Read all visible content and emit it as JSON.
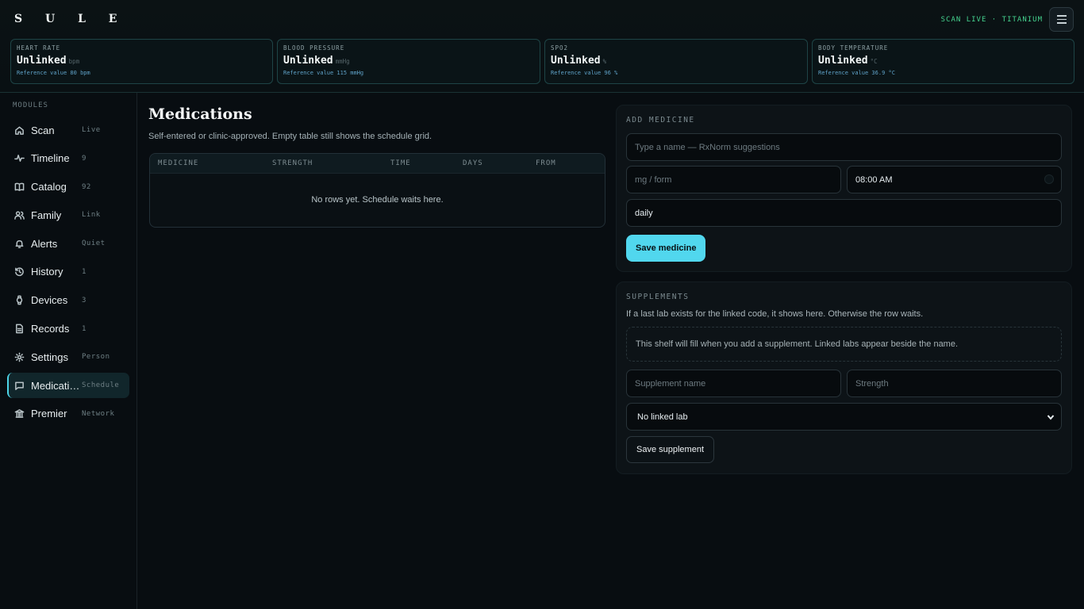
{
  "app": {
    "logo": "S U L E",
    "scan_status": "SCAN LIVE · TITANIUM"
  },
  "vitals": [
    {
      "label": "HEART RATE",
      "value": "Unlinked",
      "unit": "bpm",
      "reference": "Reference value 80 bpm"
    },
    {
      "label": "BLOOD PRESSURE",
      "value": "Unlinked",
      "unit": "mmHg",
      "reference": "Reference value 115 mmHg"
    },
    {
      "label": "SPO2",
      "value": "Unlinked",
      "unit": "%",
      "reference": "Reference value 96 %"
    },
    {
      "label": "BODY TEMPERATURE",
      "value": "Unlinked",
      "unit": "°C",
      "reference": "Reference value 36.9 °C"
    }
  ],
  "sidebar": {
    "section_label": "MODULES",
    "items": [
      {
        "label": "Scan",
        "badge": "Live",
        "icon": "home-icon"
      },
      {
        "label": "Timeline",
        "badge": "9",
        "icon": "pulse-icon"
      },
      {
        "label": "Catalog",
        "badge": "92",
        "icon": "book-icon"
      },
      {
        "label": "Family",
        "badge": "Link",
        "icon": "users-icon"
      },
      {
        "label": "Alerts",
        "badge": "Quiet",
        "icon": "bell-icon"
      },
      {
        "label": "History",
        "badge": "1",
        "icon": "history-icon"
      },
      {
        "label": "Devices",
        "badge": "3",
        "icon": "watch-icon"
      },
      {
        "label": "Records",
        "badge": "1",
        "icon": "file-icon"
      },
      {
        "label": "Settings",
        "badge": "Person",
        "icon": "gear-icon"
      },
      {
        "label": "Medications",
        "badge": "Schedule",
        "icon": "message-icon"
      },
      {
        "label": "Premier",
        "badge": "Network",
        "icon": "bank-icon"
      }
    ]
  },
  "main": {
    "title": "Medications",
    "subtitle": "Self-entered or clinic-approved. Empty table still shows the schedule grid.",
    "table": {
      "columns": [
        "MEDICINE",
        "STRENGTH",
        "TIME",
        "DAYS",
        "FROM"
      ],
      "empty_message": "No rows yet. Schedule waits here."
    }
  },
  "add_medicine": {
    "title": "ADD MEDICINE",
    "name_placeholder": "Type a name — RxNorm suggestions",
    "form_placeholder": "mg / form",
    "time_value": "08:00 AM",
    "frequency_value": "daily",
    "save_label": "Save medicine"
  },
  "supplements": {
    "title": "SUPPLEMENTS",
    "description": "If a last lab exists for the linked code, it shows here. Otherwise the row waits.",
    "shelf_message": "This shelf will fill when you add a supplement. Linked labs appear beside the name.",
    "name_placeholder": "Supplement name",
    "strength_placeholder": "Strength",
    "lab_select_value": "No linked lab",
    "save_label": "Save supplement"
  },
  "colors": {
    "accent": "#51d7ee",
    "status_green": "#45d38f",
    "reference_blue": "#5fa2c8"
  }
}
